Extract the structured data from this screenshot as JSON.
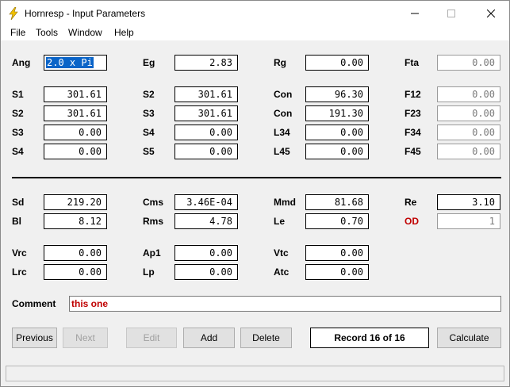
{
  "window": {
    "title": "Hornresp - Input Parameters"
  },
  "menu": [
    "File",
    "Tools",
    "Window",
    "Help"
  ],
  "fields": {
    "Ang": "2.0 x Pi",
    "Eg": "2.83",
    "Rg": "0.00",
    "Fta": "0.00",
    "S1": "301.61",
    "S2a": "301.61",
    "Con1": "96.30",
    "F12": "0.00",
    "S2": "301.61",
    "S3a": "301.61",
    "Con2": "191.30",
    "F23": "0.00",
    "S3": "0.00",
    "S4a": "0.00",
    "L34": "0.00",
    "F34": "0.00",
    "S4": "0.00",
    "S5": "0.00",
    "L45": "0.00",
    "F45": "0.00",
    "Sd": "219.20",
    "Cms": "3.46E-04",
    "Mmd": "81.68",
    "Re": "3.10",
    "Bl": "8.12",
    "Rms": "4.78",
    "Le": "0.70",
    "OD": "1",
    "Vrc": "0.00",
    "Ap1": "0.00",
    "Vtc": "0.00",
    "Lrc": "0.00",
    "Lp": "0.00",
    "Atc": "0.00"
  },
  "labels": {
    "Ang": "Ang",
    "Eg": "Eg",
    "Rg": "Rg",
    "Fta": "Fta",
    "S1": "S1",
    "S2a": "S2",
    "Con1": "Con",
    "F12": "F12",
    "S2": "S2",
    "S3a": "S3",
    "Con2": "Con",
    "F23": "F23",
    "S3": "S3",
    "S4a": "S4",
    "L34": "L34",
    "F34": "F34",
    "S4": "S4",
    "S5": "S5",
    "L45": "L45",
    "F45": "F45",
    "Sd": "Sd",
    "Cms": "Cms",
    "Mmd": "Mmd",
    "Re": "Re",
    "Bl": "Bl",
    "Rms": "Rms",
    "Le": "Le",
    "OD": "OD",
    "Vrc": "Vrc",
    "Ap1": "Ap1",
    "Vtc": "Vtc",
    "Lrc": "Lrc",
    "Lp": "Lp",
    "Atc": "Atc"
  },
  "comment": {
    "label": "Comment",
    "value": "this one"
  },
  "buttons": {
    "previous": "Previous",
    "next": "Next",
    "edit": "Edit",
    "add": "Add",
    "delete": "Delete",
    "calculate": "Calculate"
  },
  "record": "Record 16 of 16",
  "icons": {
    "app": "lightning-icon",
    "minimize": "minimize-icon",
    "maximize": "maximize-icon",
    "close": "close-icon"
  },
  "colors": {
    "selection": "#0a64c8",
    "accent_red": "#c00000"
  }
}
